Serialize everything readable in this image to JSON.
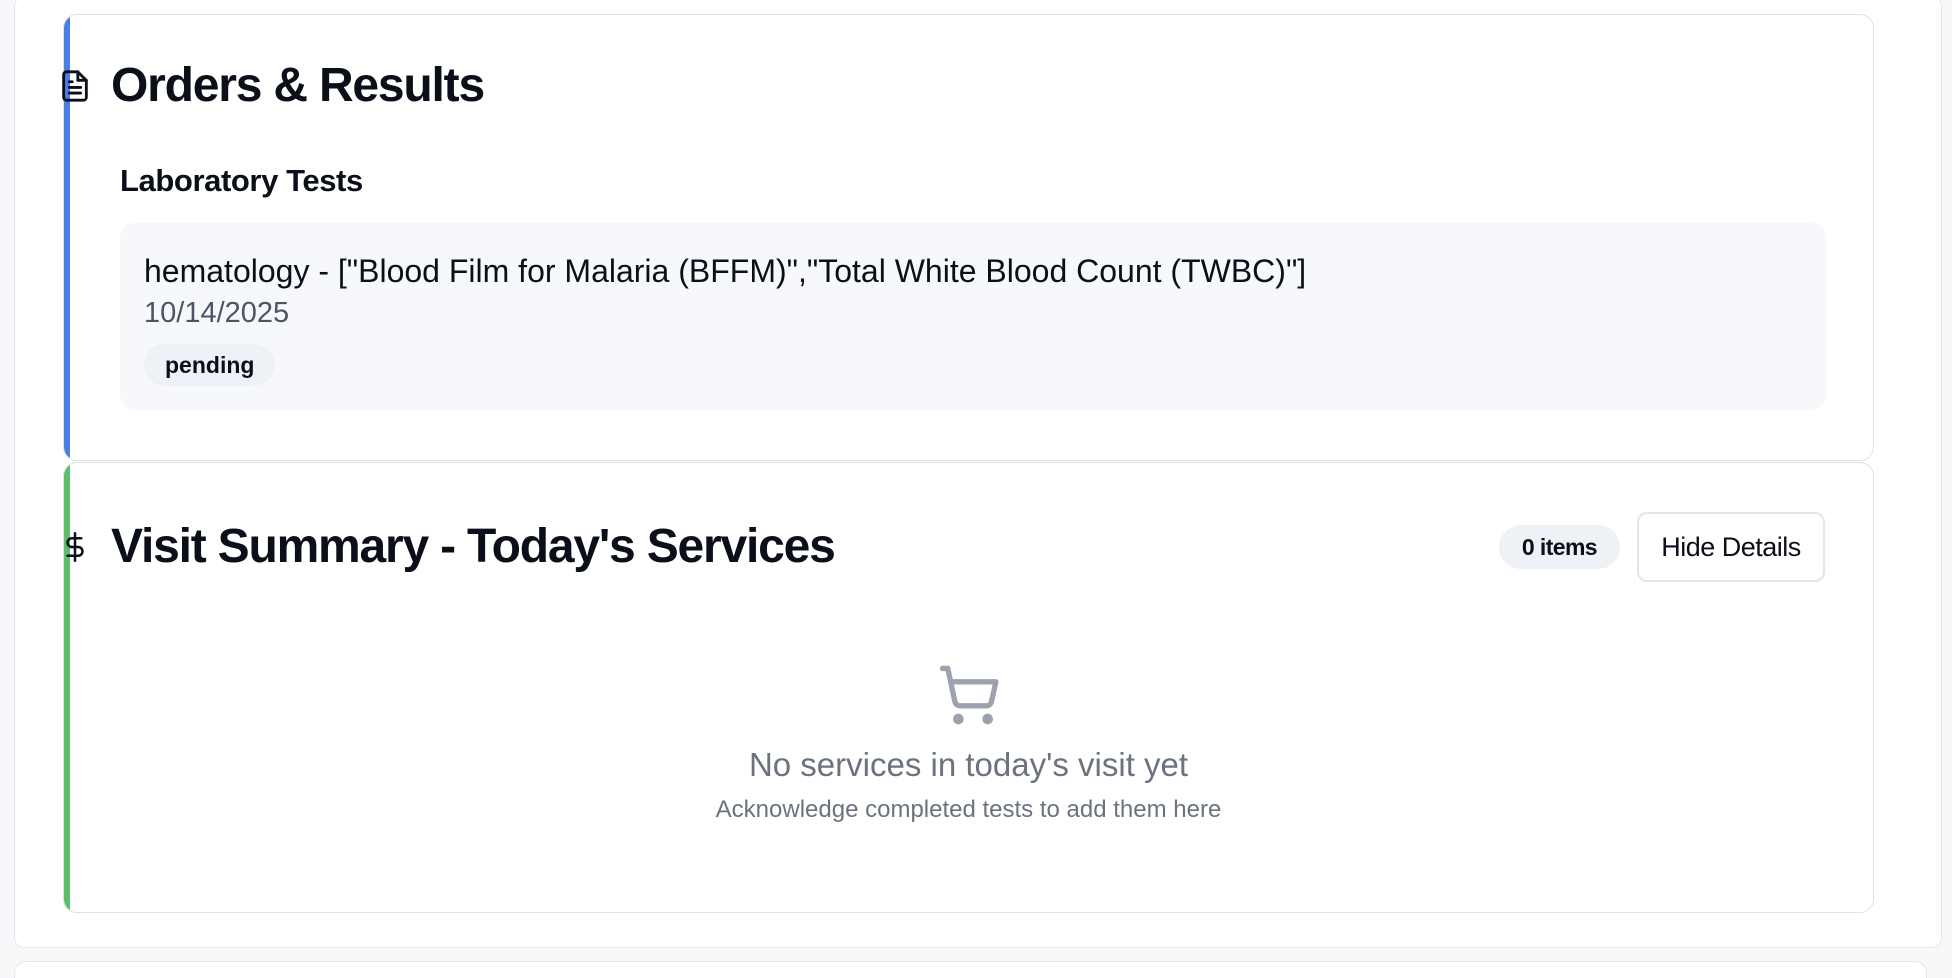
{
  "orders": {
    "title": "Orders & Results",
    "icon": "document-icon",
    "accent": "#4a7fe6",
    "section_label": "Laboratory Tests",
    "lab_items": [
      {
        "title": "hematology - [\"Blood Film for Malaria (BFFM)\",\"Total White Blood Count (TWBC)\"]",
        "date": "10/14/2025",
        "status": "pending"
      }
    ]
  },
  "visit": {
    "title": "Visit Summary - Today's Services",
    "icon": "dollar-icon",
    "accent": "#5cbf6a",
    "count_label": "0 items",
    "hide_button": "Hide Details",
    "empty_icon": "cart-icon",
    "empty_title": "No services in today's visit yet",
    "empty_subtitle": "Acknowledge completed tests to add them here"
  }
}
